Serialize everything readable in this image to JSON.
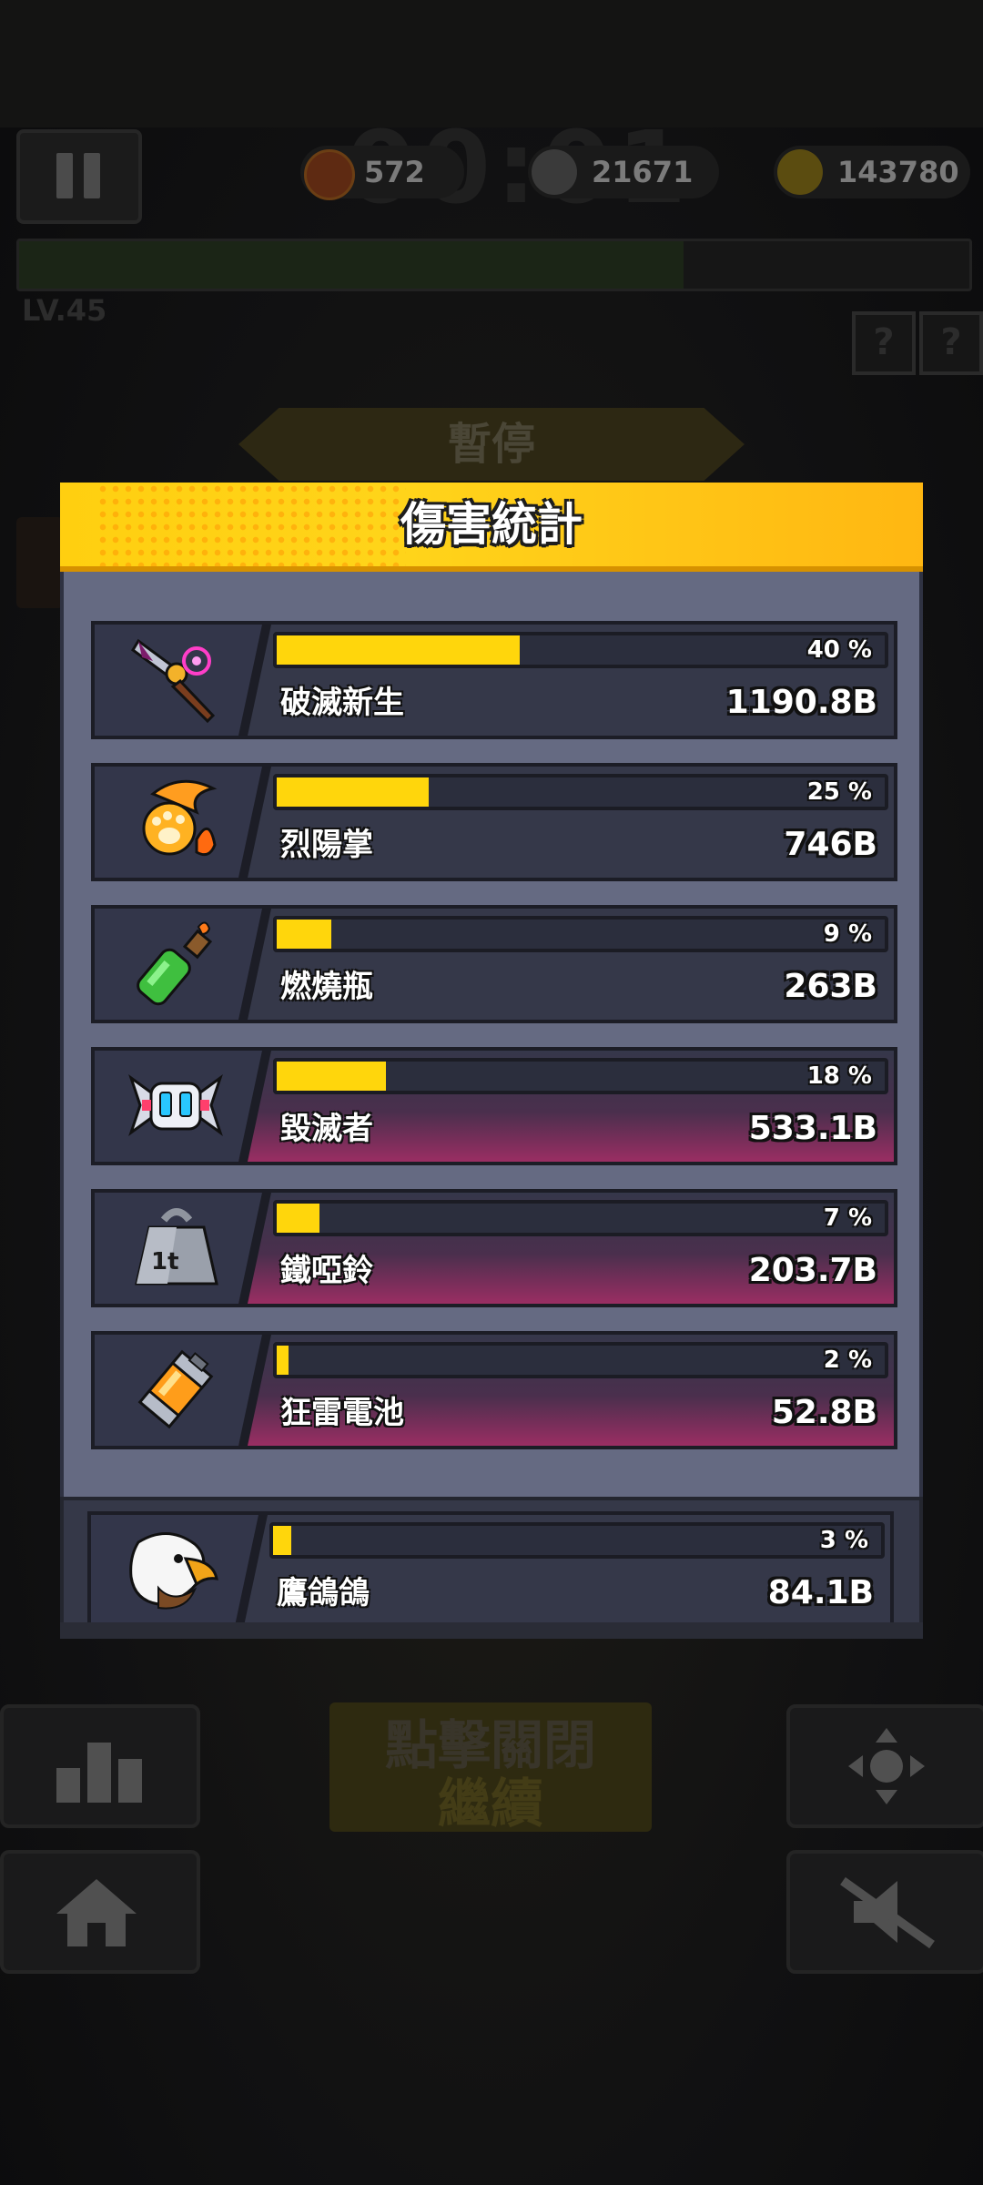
{
  "hud": {
    "hearts": "572",
    "kills": "21671",
    "coins": "143780",
    "level": "LV.45",
    "pause_label": "暫停"
  },
  "panel": {
    "title": "傷害統計",
    "rows": [
      {
        "name": "破滅新生",
        "value": "1190.8B",
        "percent": "40 %",
        "fill": 0.4,
        "icon": "purple-glaive-icon"
      },
      {
        "name": "烈陽掌",
        "value": "746B",
        "percent": "25 %",
        "fill": 0.25,
        "icon": "fire-paw-icon"
      },
      {
        "name": "燃燒瓶",
        "value": "263B",
        "percent": "9 %",
        "fill": 0.09,
        "icon": "molotov-bottle-icon"
      },
      {
        "name": "毀滅者",
        "value": "533.1B",
        "percent": "18 %",
        "fill": 0.18,
        "icon": "destroyer-drone-icon"
      },
      {
        "name": "鐵啞鈴",
        "value": "203.7B",
        "percent": "7 %",
        "fill": 0.07,
        "icon": "iron-weight-icon"
      },
      {
        "name": "狂雷電池",
        "value": "52.8B",
        "percent": "2 %",
        "fill": 0.02,
        "icon": "thunder-battery-icon"
      }
    ],
    "pet_row": {
      "name": "鷹鴿鴿",
      "value": "84.1B",
      "percent": "3 %",
      "fill": 0.03,
      "icon": "eagle-pet-icon"
    }
  },
  "buttons": {
    "continue": "繼續",
    "tap_to_close": "點擊關閉"
  },
  "colors": {
    "header_yellow": "#ffcf10",
    "bar_fill": "#ffd60c",
    "panel_body": "#656a82",
    "row_bg": "#2f3242"
  }
}
